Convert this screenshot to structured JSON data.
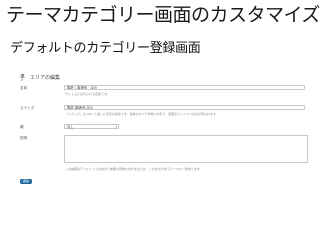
{
  "slide": {
    "title": "テーマカテゴリー画面のカスタマイズ",
    "subtitle": "デフォルトのカテゴリー登録画面"
  },
  "screen": {
    "header": "エリアの編集",
    "header_icon": "pushpin-icon",
    "fields": {
      "name_label": "名前",
      "name_value": "馬肝 / 香港島 · 中山",
      "name_help": "サイト上に表示される名前です。",
      "slug_label": "スラッグ",
      "slug_value": "馬肝-香港島-中山",
      "slug_help": "「スラッグ」は URL に適した形式の名前です。通常はすべて半角小文字で、英数字とハイフンのみが使われます。",
      "parent_label": "親",
      "parent_value": "なし",
      "description_label": "説明",
      "description_help": "この説明はデフォルトではあまり重要な意味を持ちませんが、これを表示するテーマも一部あります。"
    },
    "update_button": "更新"
  },
  "colors": {
    "button": "#2a79b5",
    "border": "#c8c8c8"
  }
}
